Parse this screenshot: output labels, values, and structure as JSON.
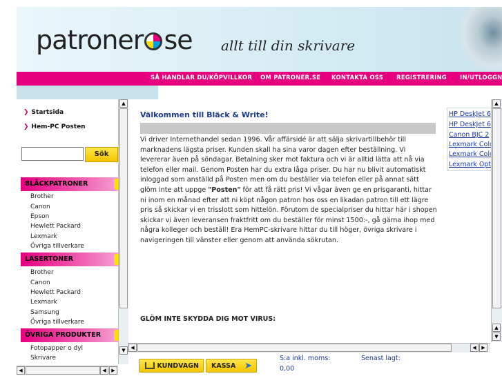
{
  "header": {
    "logo_text_left": "patroner",
    "logo_text_right": "se",
    "tagline": "allt till din skrivare"
  },
  "nav": {
    "items": [
      "SÅ HANDLAR DU/KÖPVILLKOR",
      "OM PATRONER.SE",
      "KONTAKTA OSS",
      "REGISTRERING",
      "IN/UTLOGGNING"
    ]
  },
  "sidebar": {
    "quicklinks": [
      "Startsida",
      "Hem-PC Posten"
    ],
    "search_button": "Sök",
    "search_placeholder": "",
    "categories": [
      {
        "title": "BLÄCKPATRONER",
        "items": [
          "Brother",
          "Canon",
          "Epson",
          "Hewlett Packard",
          "Lexmark",
          "Övriga tillverkare"
        ]
      },
      {
        "title": "LASERTONER",
        "items": [
          "Brother",
          "Canon",
          "Hewlett Packard",
          "Lexmark",
          "Samsung",
          "Övriga tillverkare"
        ]
      },
      {
        "title": "ÖVRIGA PRODUKTER",
        "items": [
          "Fotopapper o dyl",
          "Skrivare"
        ]
      }
    ]
  },
  "main": {
    "welcome_title": "Välkommen till Bläck & Write!",
    "intro_before": "Vi driver Internethandel sedan 1996. Vår affärsidé är att sälja skrivartillbehör till marknadens lägsta priser. Kunden skall ha sina varor dagen efter beställning. Vi levererar även på söndagar. Betalning sker mot faktura och vi är alltid lätta att nå via telefon eller mail. Genom Posten har du extra låga priser. Du har nu blivit automatiskt inloggad som anställd på Posten men om du beställer via telefon eller på annat sätt glöm inte att uppge ",
    "intro_bold": "\"Posten\"",
    "intro_after": " för att få rätt pris! Vi vågar även ge en prisgaranti, hittar ni inom en månad efter att ni köpt någon patron hos oss en likadan patron till ett lägre pris så skickar vi en trisslott som hittelön. Förutom de specialpriser du hittar här i shopen skickar vi även leveransen fraktfritt om du beställer för minst 1500:-, gå gärna ihop med några kolleger och beställ! Era HemPC-skrivare hittar du till höger, övriga skrivare i navigeringen till vänster eller genom att använda sökrutan.",
    "virus_heading": "GLÖM INTE SKYDDA DIG MOT VIRUS:"
  },
  "rightcol": {
    "links": [
      "HP DeskJet 6",
      "HP DeskJet 6",
      "Canon BJC 2",
      "Lexmark Colo",
      "Lexmark Colo",
      "Lexmark Optr"
    ]
  },
  "bottom": {
    "cart_label": "KUNDVAGN",
    "checkout_label": "KASSA",
    "total_label": "S:a inkl. moms:",
    "total_value": "0,00",
    "last_added_label": "Senast lagt:"
  },
  "colors": {
    "brand_pink": "#e6007e",
    "header_bg": "#d6edf4",
    "button_yellow": "#f5c400",
    "link_blue": "#1a3aa0"
  }
}
